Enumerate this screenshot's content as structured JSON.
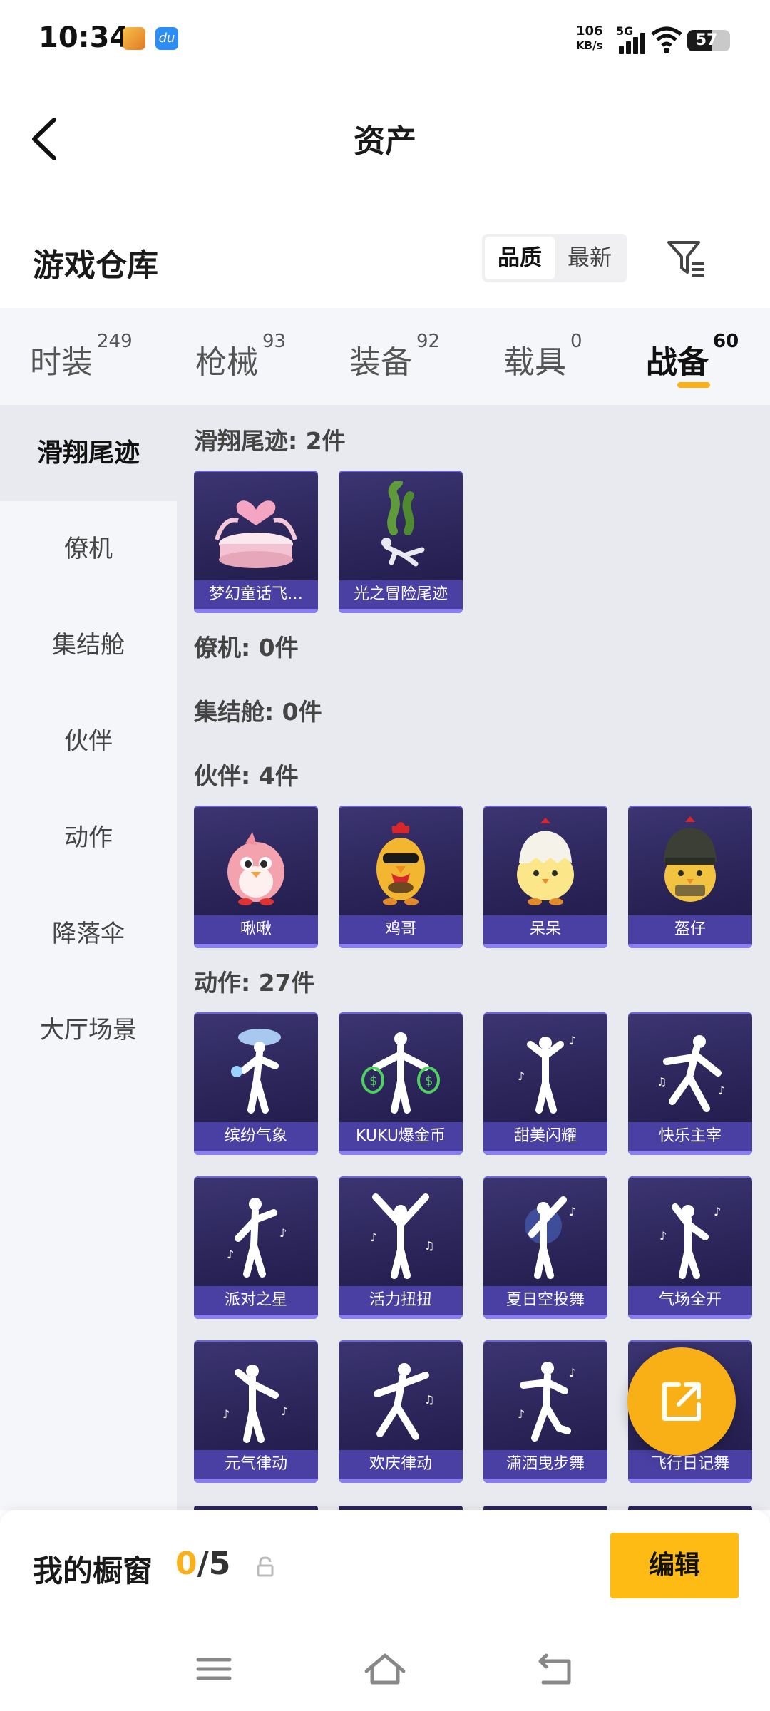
{
  "status_bar": {
    "time": "10:34",
    "net_speed_value": "106",
    "net_speed_unit": "KB/s",
    "network": "5G",
    "battery": "57"
  },
  "header": {
    "title": "资产"
  },
  "warehouse": {
    "title": "游戏仓库",
    "sort_options": [
      "品质",
      "最新"
    ],
    "sort_selected": "品质"
  },
  "tabs": [
    {
      "label": "时装",
      "count": "249"
    },
    {
      "label": "枪械",
      "count": "93"
    },
    {
      "label": "装备",
      "count": "92"
    },
    {
      "label": "载具",
      "count": "0"
    },
    {
      "label": "战备",
      "count": "60",
      "active": true
    }
  ],
  "sidebar": {
    "items": [
      {
        "label": "滑翔尾迹",
        "active": true
      },
      {
        "label": "僚机"
      },
      {
        "label": "集结舱"
      },
      {
        "label": "伙伴"
      },
      {
        "label": "动作"
      },
      {
        "label": "降落伞"
      },
      {
        "label": "大厅场景"
      }
    ]
  },
  "groups": [
    {
      "title": "滑翔尾迹: 2件",
      "items": [
        {
          "label": "梦幻童话飞…",
          "icon": "heart-bed-icon"
        },
        {
          "label": "光之冒险尾迹",
          "icon": "smoke-trail-icon"
        }
      ]
    },
    {
      "title": "僚机: 0件",
      "items": []
    },
    {
      "title": "集结舱: 0件",
      "items": []
    },
    {
      "title": "伙伴: 4件",
      "items": [
        {
          "label": "啾啾",
          "icon": "pink-bird-icon"
        },
        {
          "label": "鸡哥",
          "icon": "sunglasses-chicken-icon"
        },
        {
          "label": "呆呆",
          "icon": "egg-chick-icon"
        },
        {
          "label": "盔仔",
          "icon": "helmet-chick-icon"
        }
      ]
    },
    {
      "title": "动作: 27件",
      "items": [
        {
          "label": "缤纷气象",
          "icon": "dance-pose-icon"
        },
        {
          "label": "KUKU爆金币",
          "icon": "money-bag-pose-icon"
        },
        {
          "label": "甜美闪耀",
          "icon": "dance-pose-icon"
        },
        {
          "label": "快乐主宰",
          "icon": "dance-pose-icon"
        },
        {
          "label": "派对之星",
          "icon": "dance-pose-icon"
        },
        {
          "label": "活力扭扭",
          "icon": "dance-pose-icon"
        },
        {
          "label": "夏日空投舞",
          "icon": "dance-pose-icon"
        },
        {
          "label": "气场全开",
          "icon": "dance-pose-icon"
        },
        {
          "label": "元气律动",
          "icon": "dance-pose-icon"
        },
        {
          "label": "欢庆律动",
          "icon": "dance-pose-icon"
        },
        {
          "label": "潇洒曳步舞",
          "icon": "dance-pose-icon"
        },
        {
          "label": "飞行日记舞",
          "icon": "dance-pose-icon"
        }
      ]
    }
  ],
  "showcase": {
    "title": "我的橱窗",
    "used": "0",
    "separator": "/",
    "total": "5",
    "edit_label": "编辑"
  },
  "colors": {
    "accent": "#f9b01a",
    "card_bg": "#2a2458",
    "card_label_bg": "#4a3fa3"
  }
}
